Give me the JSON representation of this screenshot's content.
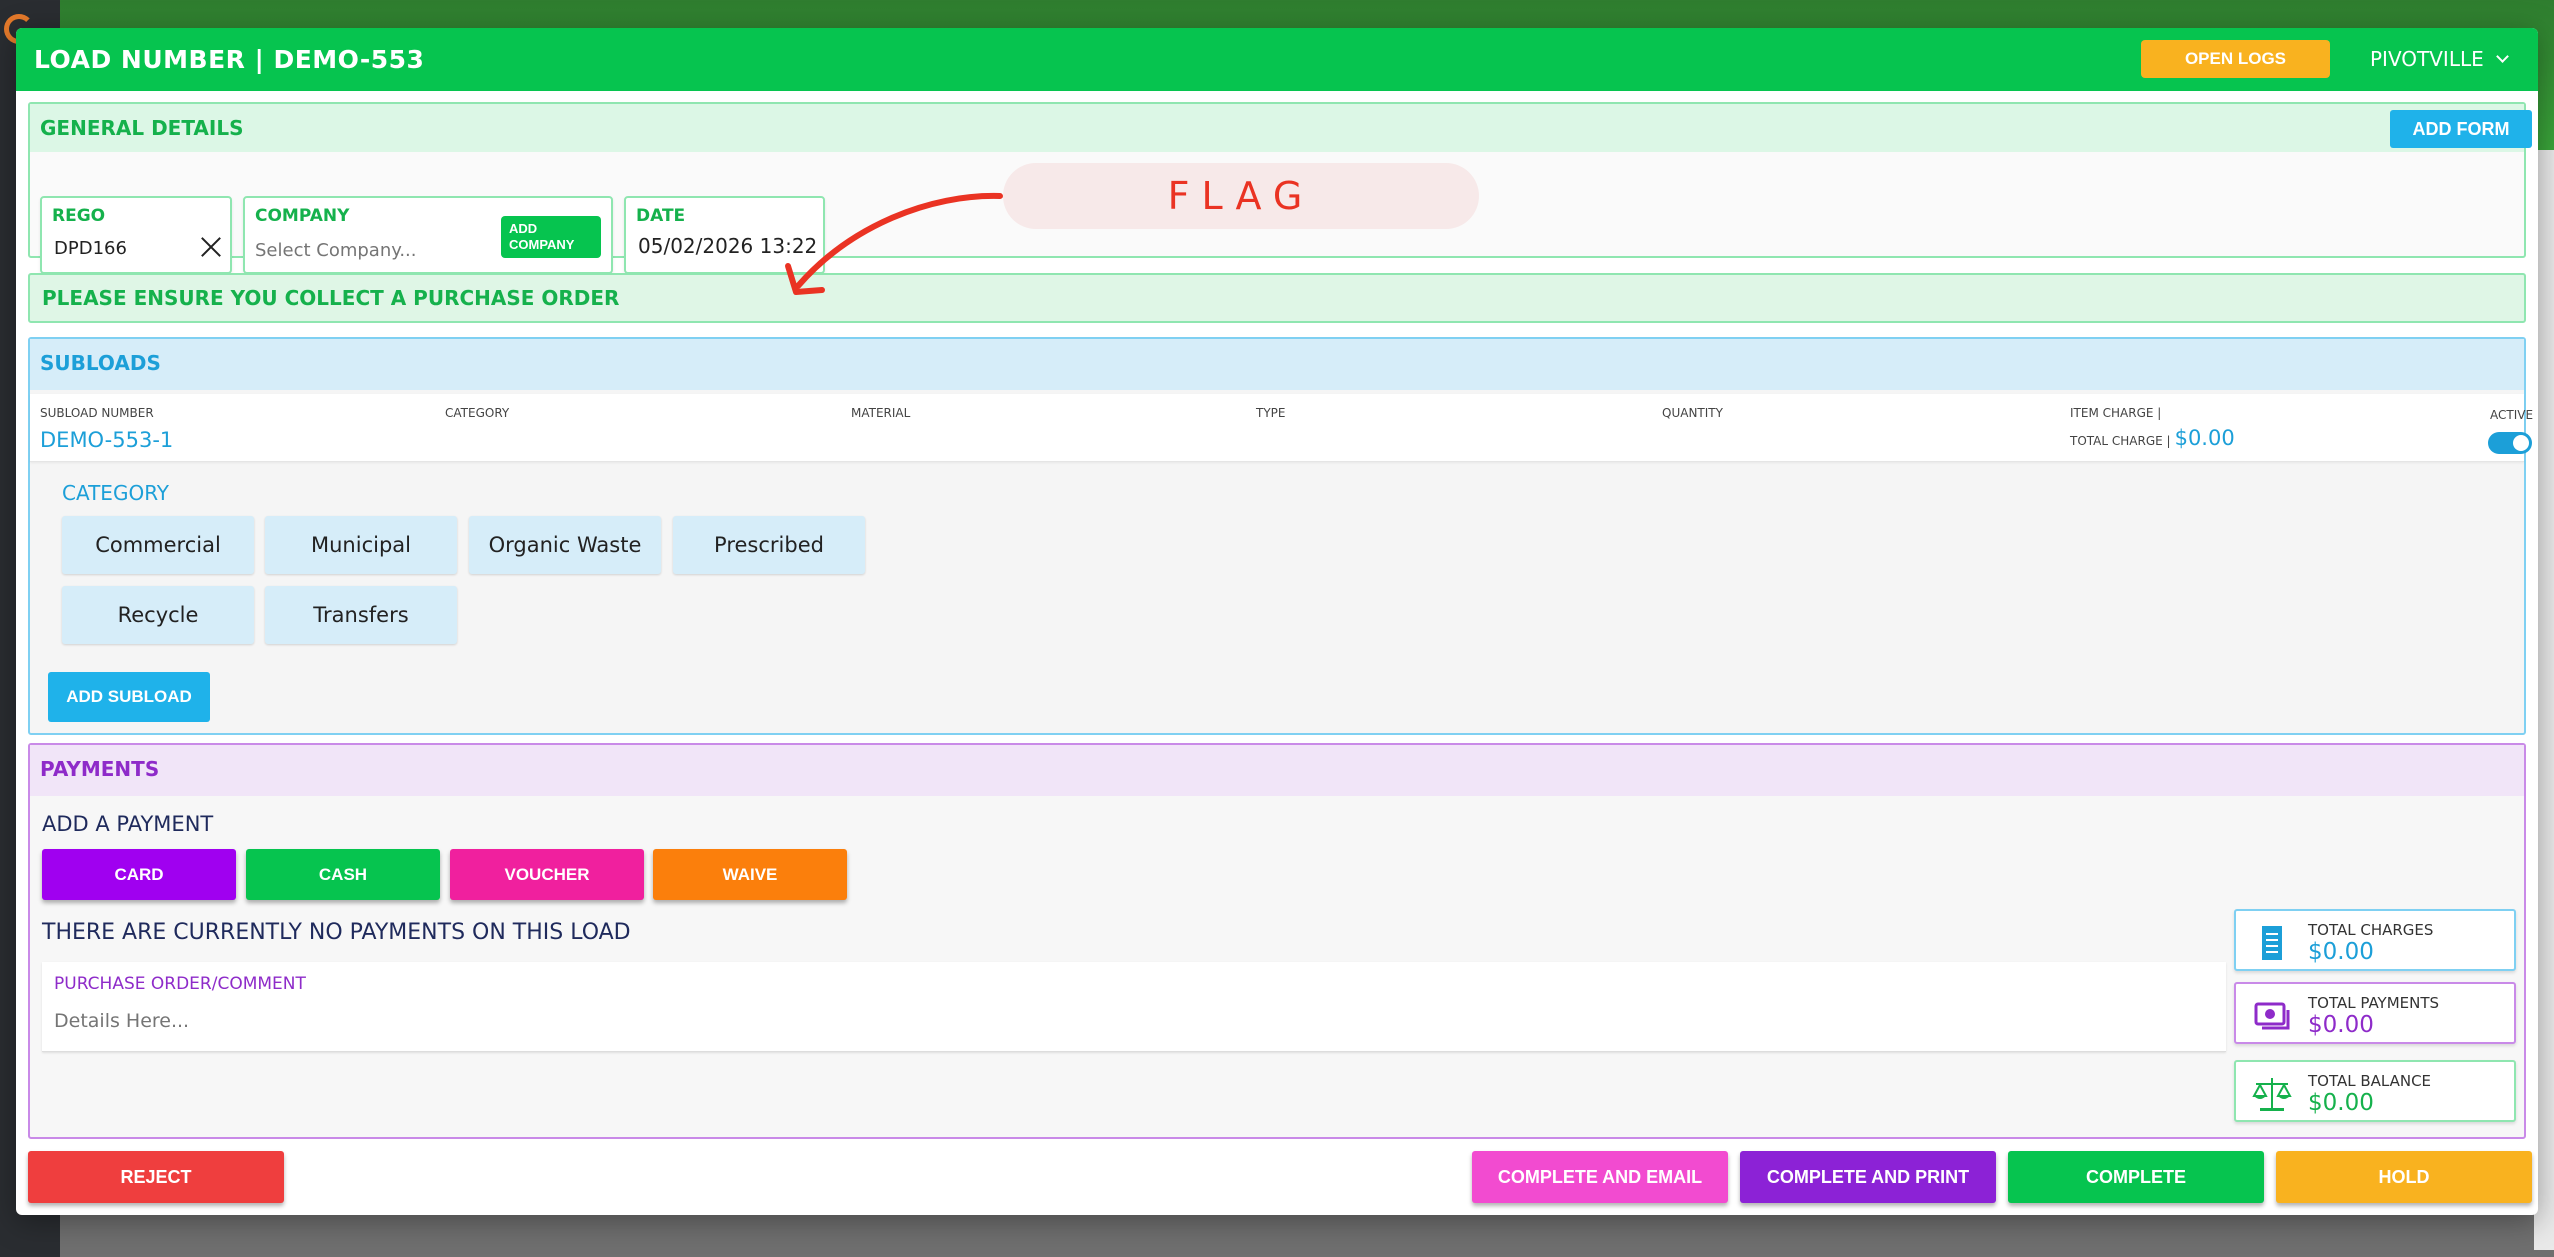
{
  "header": {
    "title": "LOAD NUMBER | DEMO-553",
    "open_logs_label": "OPEN LOGS",
    "site": "PIVOTVILLE"
  },
  "general": {
    "title": "GENERAL DETAILS",
    "add_form_label": "ADD FORM",
    "rego_label": "REGO",
    "rego_value": "DPD166",
    "company_label": "COMPANY",
    "company_placeholder": "Select Company...",
    "add_company_label": "ADD COMPANY",
    "date_label": "DATE",
    "date_value": "05/02/2026 13:22",
    "flag_text": "FLAG"
  },
  "banner": {
    "text": "PLEASE ENSURE YOU COLLECT A PURCHASE ORDER"
  },
  "subloads": {
    "title": "SUBLOADS",
    "columns": {
      "subload_number": "SUBLOAD NUMBER",
      "category": "CATEGORY",
      "material": "MATERIAL",
      "type": "TYPE",
      "quantity": "QUANTITY",
      "item_charge": "ITEM CHARGE |",
      "total_charge": "TOTAL CHARGE |",
      "active": "ACTIVE"
    },
    "row": {
      "number": "DEMO-553-1",
      "total_charge": "$0.00",
      "active": true
    },
    "category_title": "CATEGORY",
    "categories": [
      "Commercial",
      "Municipal",
      "Organic Waste",
      "Prescribed",
      "Recycle",
      "Transfers"
    ],
    "add_subload_label": "ADD SUBLOAD"
  },
  "payments": {
    "title": "PAYMENTS",
    "add_payment_label": "ADD A PAYMENT",
    "methods": [
      {
        "label": "CARD",
        "color": "#a000f0"
      },
      {
        "label": "CASH",
        "color": "#06c44f"
      },
      {
        "label": "VOUCHER",
        "color": "#f0209e"
      },
      {
        "label": "WAIVE",
        "color": "#fb7f0c"
      }
    ],
    "no_payments_text": "THERE ARE CURRENTLY NO PAYMENTS ON THIS LOAD",
    "po_label": "PURCHASE ORDER/COMMENT",
    "po_placeholder": "Details Here...",
    "totals": {
      "charges_label": "TOTAL CHARGES",
      "charges_value": "$0.00",
      "payments_label": "TOTAL PAYMENTS",
      "payments_value": "$0.00",
      "balance_label": "TOTAL BALANCE",
      "balance_value": "$0.00"
    }
  },
  "footer": {
    "reject_label": "REJECT",
    "complete_email_label": "COMPLETE AND EMAIL",
    "complete_print_label": "COMPLETE AND PRINT",
    "complete_label": "COMPLETE",
    "hold_label": "HOLD"
  },
  "colors": {
    "primary_green": "#06c44f",
    "accent_blue": "#1c9fd8",
    "accent_purple": "#8e2bc9",
    "hold_yellow": "#f9b21f",
    "reject_red": "#ef3e3e",
    "flag_red": "#ea3323"
  }
}
